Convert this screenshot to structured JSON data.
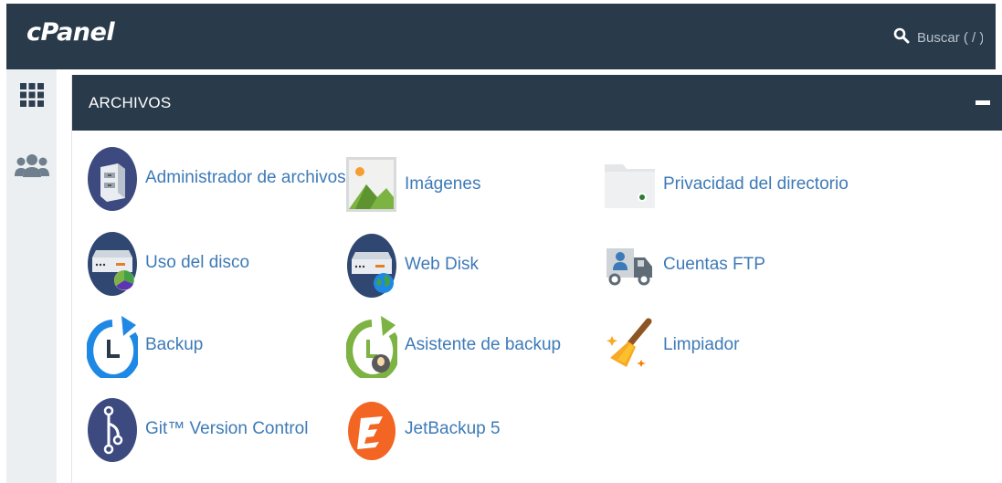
{
  "header": {
    "logo": "cPanel",
    "search_placeholder": "Buscar ( / )",
    "search_icon": "search-icon"
  },
  "sidebar": {
    "items": [
      {
        "icon": "grid-icon"
      },
      {
        "icon": "users-icon"
      }
    ]
  },
  "section": {
    "title": "ARCHIVOS",
    "collapse_icon": "minus-icon",
    "items": [
      {
        "label": "Administrador de archivos",
        "icon": "file-cabinet-icon"
      },
      {
        "label": "Imágenes",
        "icon": "image-icon"
      },
      {
        "label": "Privacidad del directorio",
        "icon": "folder-eye-icon"
      },
      {
        "label": "Uso del disco",
        "icon": "disk-usage-icon"
      },
      {
        "label": "Web Disk",
        "icon": "web-disk-icon"
      },
      {
        "label": "Cuentas FTP",
        "icon": "ftp-truck-icon"
      },
      {
        "label": "Backup",
        "icon": "backup-clock-icon"
      },
      {
        "label": "Asistente de backup",
        "icon": "backup-wizard-icon"
      },
      {
        "label": "Limpiador",
        "icon": "broom-icon"
      },
      {
        "label": "Git™ Version Control",
        "icon": "git-icon"
      },
      {
        "label": "JetBackup 5",
        "icon": "jetbackup-icon"
      }
    ]
  },
  "colors": {
    "header_bg": "#293a4a",
    "link": "#3d7ab8",
    "sidebar_bg": "#eceff1"
  }
}
